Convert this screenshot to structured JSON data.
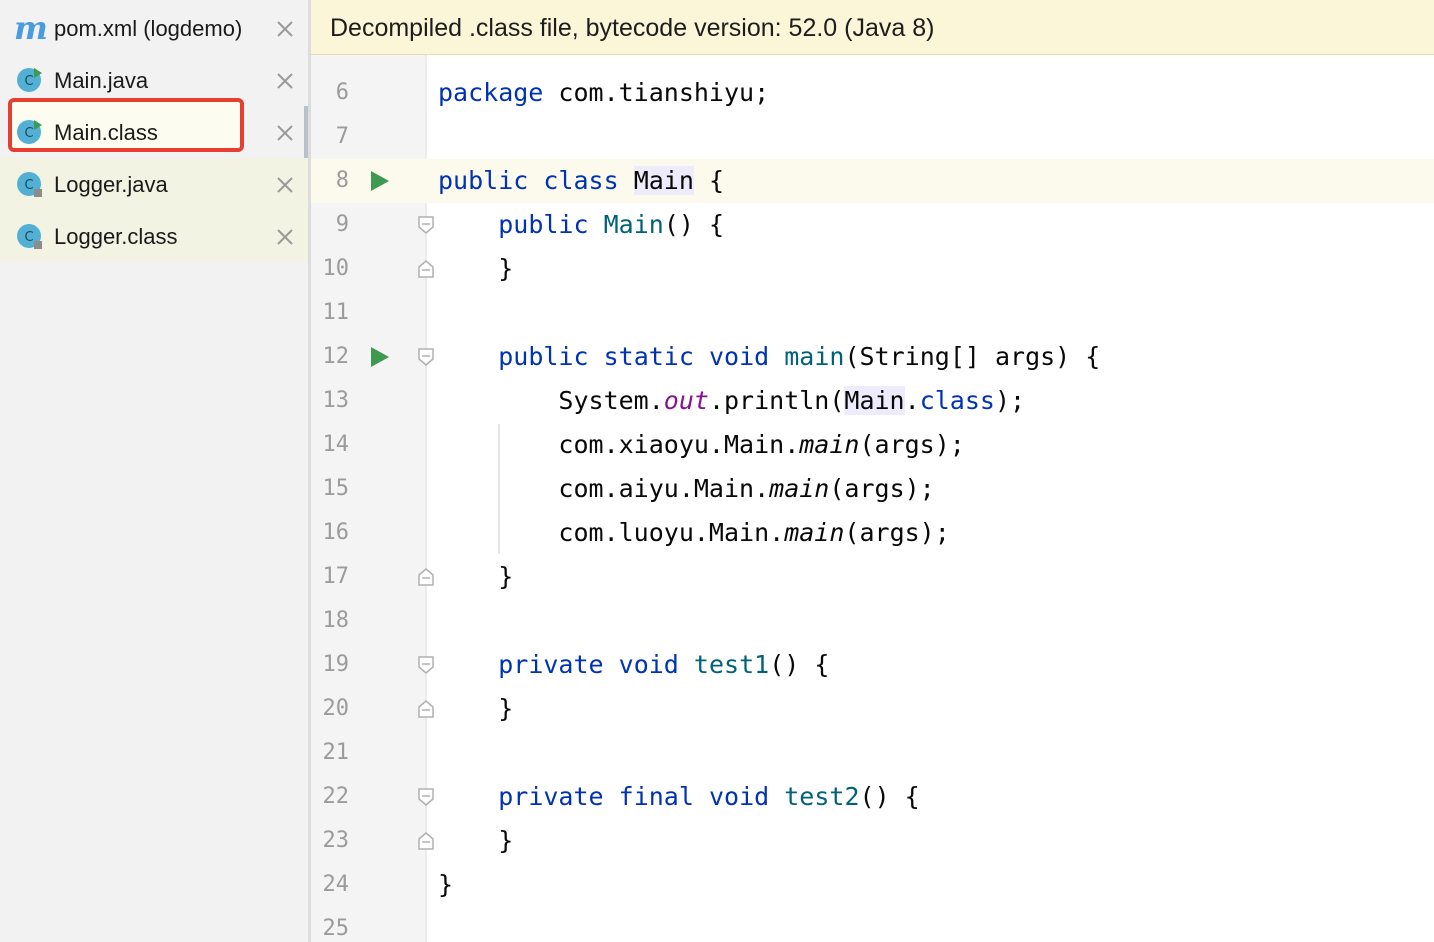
{
  "tabs": [
    {
      "label": "pom.xml (logdemo)",
      "icon": "maven-icon"
    },
    {
      "label": "Main.java",
      "icon": "java-class-runnable-icon"
    },
    {
      "label": "Main.class",
      "icon": "java-class-runnable-icon"
    },
    {
      "label": "Logger.java",
      "icon": "java-class-icon"
    },
    {
      "label": "Logger.class",
      "icon": "java-class-icon"
    }
  ],
  "banner": {
    "text": "Decompiled .class file, bytecode version: 52.0 (Java 8)"
  },
  "editor": {
    "line_numbers": [
      "6",
      "7",
      "8",
      "9",
      "10",
      "11",
      "12",
      "13",
      "14",
      "15",
      "16",
      "17",
      "18",
      "19",
      "20",
      "21",
      "22",
      "23",
      "24",
      "25"
    ],
    "code": {
      "l6_kw": "package",
      "l6_rest": " com.tianshiyu;",
      "l8_kw1": "public",
      "l8_kw2": "class",
      "l8_name": "Main",
      "l8_brace": " {",
      "l9_kw": "public",
      "l9_name": "Main",
      "l9_rest": "() {",
      "l10": "}",
      "l12_kw1": "public",
      "l12_kw2": "static",
      "l12_kw3": "void",
      "l12_name": "main",
      "l12_rest": "(String[] args) {",
      "l13_a": "System.",
      "l13_out": "out",
      "l13_b": ".println(",
      "l13_main": "Main",
      "l13_dot": ".",
      "l13_class": "class",
      "l13_c": ");",
      "l14_a": "com.xiaoyu.Main.",
      "l14_main": "main",
      "l14_b": "(args);",
      "l15_a": "com.aiyu.Main.",
      "l15_main": "main",
      "l15_b": "(args);",
      "l16_a": "com.luoyu.Main.",
      "l16_main": "main",
      "l16_b": "(args);",
      "l17": "}",
      "l19_kw1": "private",
      "l19_kw2": "void",
      "l19_name": "test1",
      "l19_rest": "() {",
      "l20": "}",
      "l22_kw1": "private",
      "l22_kw2": "final",
      "l22_kw3": "void",
      "l22_name": "test2",
      "l22_rest": "() {",
      "l23": "}",
      "l24": "}"
    }
  },
  "colors": {
    "keyword": "#0033b3",
    "method": "#00627a",
    "static_field": "#871094",
    "selection_box": "#e63e2f",
    "banner_bg": "#fbf6d8",
    "run_marker": "#3d9a50"
  },
  "gutter_icons": [
    "run-icon",
    "fold-icon"
  ]
}
